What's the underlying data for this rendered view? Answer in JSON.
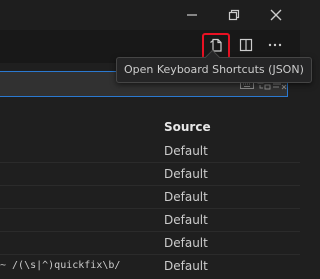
{
  "tooltip": {
    "text": "Open Keyboard Shortcuts (JSON)"
  },
  "table": {
    "source_header": "Source",
    "rows": [
      {
        "when": "",
        "source": "Default"
      },
      {
        "when": "",
        "source": "Default"
      },
      {
        "when": "",
        "source": "Default"
      },
      {
        "when": "",
        "source": "Default"
      },
      {
        "when": "",
        "source": "Default"
      },
      {
        "when": "~ /(\\s|^)quickfix\\b/",
        "source": "Default"
      }
    ]
  },
  "icons": {
    "minimize": "minimize-icon",
    "restore": "restore-icon",
    "close": "close-icon",
    "open_json": "open-json-file-icon",
    "split_editor": "split-editor-icon",
    "more_actions": "more-actions-icon",
    "record_keys": "keyboard-icon",
    "sort_precedence": "sort-by-precedence-icon",
    "clear_input": "clear-input-icon"
  },
  "colors": {
    "highlight_border": "#e81123",
    "search_focus_border": "#2b79d0"
  }
}
